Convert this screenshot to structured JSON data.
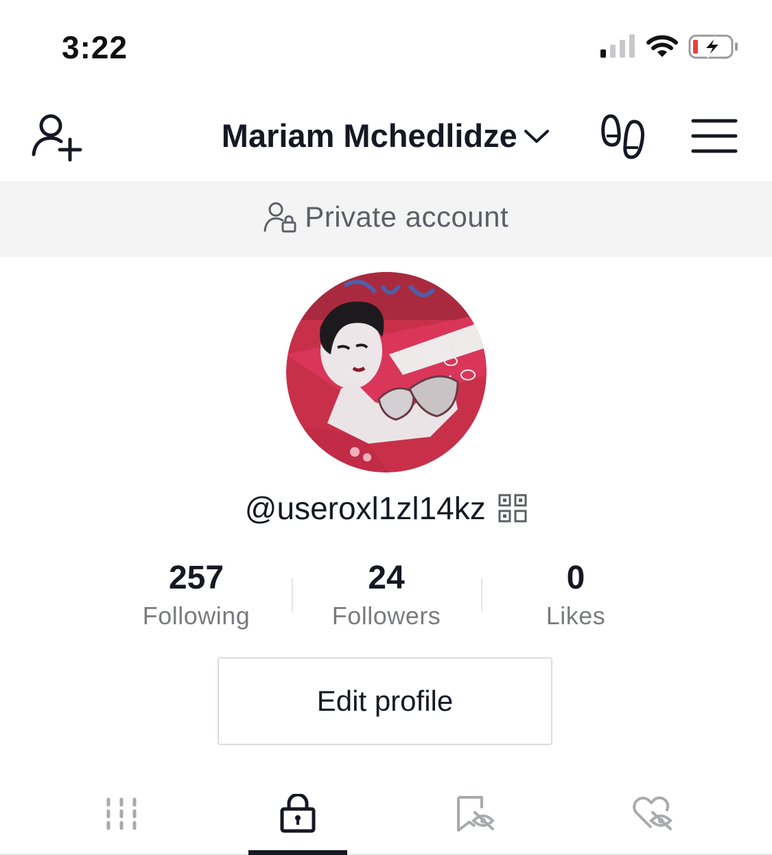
{
  "status_bar": {
    "time": "3:22",
    "icons": [
      "signal-icon",
      "wifi-icon",
      "battery-charging-icon"
    ],
    "battery_color": "#e9403a"
  },
  "header": {
    "title": "Mariam Mchedlidze",
    "icons": [
      "add-user-icon",
      "chevron-down-icon",
      "footprints-icon",
      "menu-icon"
    ]
  },
  "banner": {
    "text": "Private account",
    "icon": "user-lock-icon"
  },
  "profile": {
    "username": "@useroxl1zl14kz",
    "qr_icon": "qr-code-icon"
  },
  "stats": [
    {
      "value": "257",
      "label": "Following"
    },
    {
      "value": "24",
      "label": "Followers"
    },
    {
      "value": "0",
      "label": "Likes"
    }
  ],
  "edit_button": "Edit profile",
  "tabs": [
    {
      "icon": "grid-icon",
      "active": false
    },
    {
      "icon": "lock-icon",
      "active": true
    },
    {
      "icon": "bookmark-hidden-icon",
      "active": false
    },
    {
      "icon": "heart-hidden-icon",
      "active": false
    }
  ],
  "colors": {
    "text": "#161823",
    "secondary": "#7a7b80",
    "banner_bg": "#f4f4f5"
  }
}
